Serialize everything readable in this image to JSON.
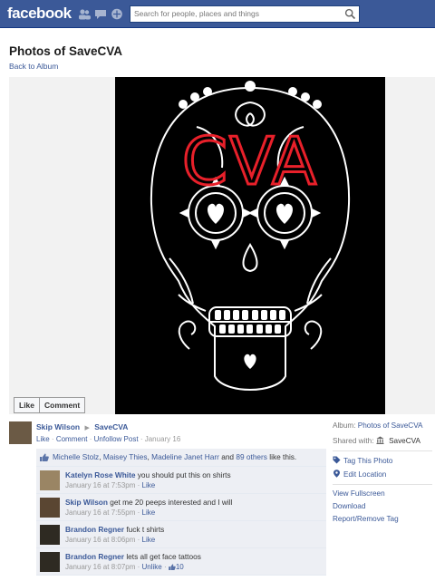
{
  "topbar": {
    "logo": "facebook",
    "search_placeholder": "Search for people, places and things",
    "jewels": [
      "friends-icon",
      "messages-icon",
      "notifications-icon"
    ]
  },
  "page": {
    "title": "Photos of SaveCVA",
    "back_link": "Back to Album"
  },
  "photo": {
    "art_text": "CVA",
    "accent_color": "#e8202a",
    "stage_actions": [
      "Like",
      "Comment"
    ]
  },
  "story": {
    "author": "Skip Wilson",
    "arrow": "▶",
    "target": "SaveCVA",
    "actions": [
      "Like",
      "Comment",
      "Unfollow Post"
    ],
    "sep": "·",
    "date": "January 16"
  },
  "likes": {
    "names": [
      "Michelle Stolz",
      "Maisey Thies",
      "Madeline Janet Harr"
    ],
    "joiner": ",",
    "and_text": "and",
    "others": "89 others",
    "tail": "like this."
  },
  "comments": [
    {
      "author": "Katelyn Rose White",
      "text": "you should put this on shirts",
      "time": "January 16 at 7:53pm",
      "action": "Like",
      "avatar_color": "#9a8564"
    },
    {
      "author": "Skip Wilson",
      "text": "get me 20 peeps interested and I will",
      "time": "January 16 at 7:55pm",
      "action": "Like",
      "avatar_color": "#5a4632"
    },
    {
      "author": "Brandon Regner",
      "text": "fuck t shirts",
      "time": "January 16 at 8:06pm",
      "action": "Like",
      "avatar_color": "#2e2a22"
    },
    {
      "author": "Brandon Regner",
      "text": "lets all get face tattoos",
      "time": "January 16 at 8:07pm",
      "action": "Unlike",
      "like_count": "10",
      "avatar_color": "#2e2a22"
    }
  ],
  "sidebar": {
    "album_label": "Album:",
    "album_link": "Photos of SaveCVA",
    "shared_label": "Shared with:",
    "shared_value": "SaveCVA",
    "actions": [
      "Tag This Photo",
      "Edit Location"
    ],
    "links": [
      "View Fullscreen",
      "Download",
      "Report/Remove Tag"
    ]
  }
}
